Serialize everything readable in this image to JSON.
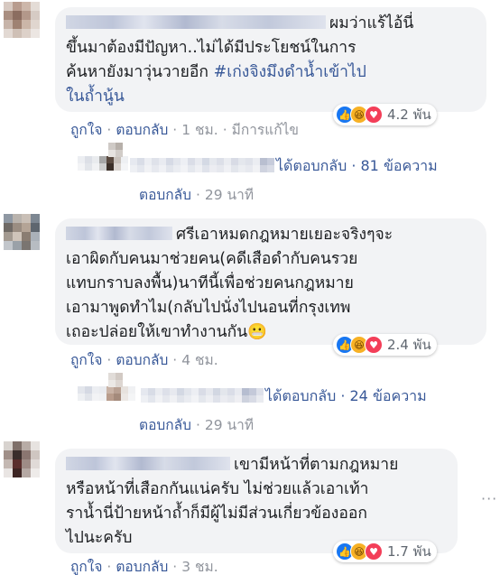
{
  "comments": [
    {
      "lines": [
        "ผมว่าแร้ไอ้นี่",
        "ขึ้นมาต้องมีปัญหา..ไม่ได้มีประโยชน์ในการ",
        "ค้นหายังมาวุ่นวายอีก "
      ],
      "hashtag_line1": "#เก่งจิงมึงดำน้ำเข้าไป",
      "hashtag_line2": "ในถ้ำนู้น",
      "reaction_count": "4.2 พัน",
      "like": "ถูกใจ",
      "reply": "ตอบกลับ",
      "time": "1 ชม.",
      "edited": "มีการแก้ไข",
      "replies_text": "ได้ตอบกลับ · 81 ข้อความ",
      "sub_reply": "ตอบกลับ",
      "sub_time": "29 นาที"
    },
    {
      "lines": [
        "ศรีเอาหมดกฎหมายเยอะจริงๆจะ",
        "เอาผิดกับคนมาช่วยคน(คดีเสือดำกับคนรวย",
        "แทบกราบลงพื้น)นาทีนี้เพื่อช่วยคนกฎหมาย",
        "เอามาพูดทำไม(กลับไปนั่งไปนอนที่กรุงเทพ",
        "เถอะปล่อยให้เขาทำงานกัน"
      ],
      "emoji": "😬",
      "reaction_count": "2.4 พัน",
      "like": "ถูกใจ",
      "reply": "ตอบกลับ",
      "time": "4 ชม.",
      "replies_text": "ได้ตอบกลับ · 24 ข้อความ",
      "sub_reply": "ตอบกลับ",
      "sub_time": "29 นาที"
    },
    {
      "lines": [
        "เขามีหน้าที่ตามกฎหมาย",
        "หรือหน้าที่เสือกกันแน่ครับ ไม่ช่วยแล้วเอาเท้า",
        "ราน้ำนี่ป้ายหน้าถ้ำก็มีผู้ไม่มีส่วนเกี่ยวข้องออก",
        "ไปนะครับ"
      ],
      "reaction_count": "1.7 พัน",
      "like": "ถูกใจ",
      "reply": "ตอบกลับ",
      "time": "3 ชม."
    }
  ],
  "icons": {
    "like": "like-icon",
    "haha": "haha-icon",
    "love": "love-icon",
    "more": "more-options-icon"
  },
  "colors": {
    "link": "#385898",
    "meta": "#90949c",
    "bubble": "#f2f3f5",
    "text": "#1c1e21"
  }
}
